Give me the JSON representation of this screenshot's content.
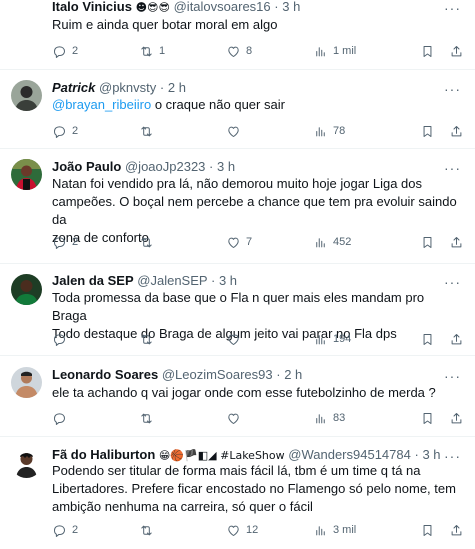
{
  "tweets": [
    {
      "name": "Italo Vinicius",
      "emojis": "☻😎😎",
      "handle": "@italovsoares16",
      "time": "3 h",
      "text_lines": [
        "Ruim e ainda quer botar moral em algo"
      ],
      "mention": "",
      "replies": "2",
      "retweets": "1",
      "likes": "8",
      "views": "1 mil"
    },
    {
      "name": "Patrick",
      "emojis": "",
      "handle": "@pknvsty",
      "time": "2 h",
      "text_lines": [
        "o craque não quer sair"
      ],
      "mention": "@brayan_ribeiiro",
      "replies": "2",
      "retweets": "",
      "likes": "",
      "views": "78"
    },
    {
      "name": "João Paulo",
      "emojis": "",
      "handle": "@joaoJp2323",
      "time": "3 h",
      "text_lines": [
        "Natan foi vendido pra lá, não demorou muito hoje jogar Liga dos",
        "campeões. O boçal nem percebe a chance que tem pra evoluir saindo da",
        "zona de conforto"
      ],
      "mention": "",
      "replies": "2",
      "retweets": "",
      "likes": "7",
      "views": "452"
    },
    {
      "name": "Jalen da SEP",
      "emojis": "",
      "handle": "@JalenSEP",
      "time": "3 h",
      "text_lines": [
        "Toda promessa da base que o Fla n quer mais eles mandam pro Braga",
        "Todo destaque do Braga de algum jeito vai parar no Fla dps"
      ],
      "mention": "",
      "replies": "",
      "retweets": "",
      "likes": "",
      "views": "194"
    },
    {
      "name": "Leonardo Soares",
      "emojis": "",
      "handle": "@LeozimSoares93",
      "time": "2 h",
      "text_lines": [
        "ele ta achando q vai jogar onde com esse futebolzinho de merda ?"
      ],
      "mention": "",
      "replies": "",
      "retweets": "",
      "likes": "",
      "views": "83"
    },
    {
      "name": "Fã do Haliburton",
      "emojis": "😁🏀🏴◧◢ #LakeShow",
      "handle": "@Wanders94514784",
      "time": "3 h",
      "text_lines": [
        "Podendo ser titular de forma mais fácil lá, tbm é um time q tá na",
        "Libertadores. Prefere ficar encostado no Flamengo só pelo nome, tem",
        "ambição nenhuma na carreira, só quer o fácil"
      ],
      "mention": "",
      "replies": "2",
      "retweets": "",
      "likes": "12",
      "views": "3 mil"
    }
  ],
  "more_glyph": "···",
  "separator": "·",
  "icons": {
    "reply": "reply-icon",
    "retweet": "retweet-icon",
    "like": "heart-icon",
    "views": "views-chart-icon",
    "bookmark": "bookmark-icon",
    "share": "share-icon"
  },
  "colors": {
    "text": "#0f1419",
    "secondary": "#536471",
    "link": "#1d9bf0",
    "divider": "#eff3f4"
  }
}
